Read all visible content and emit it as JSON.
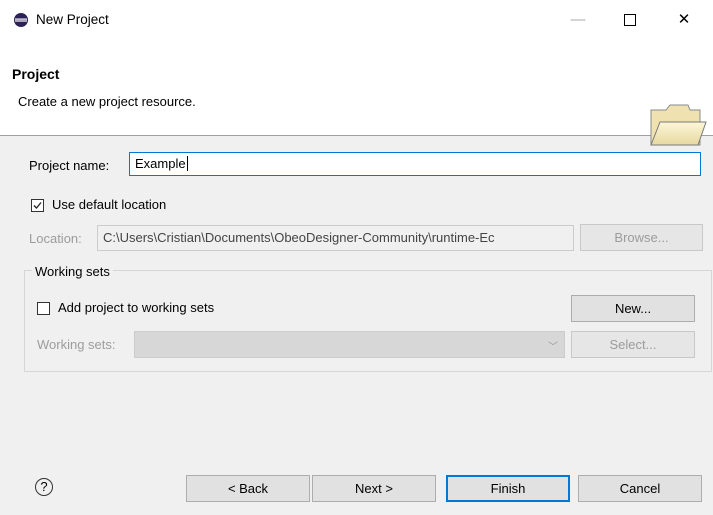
{
  "window": {
    "title": "New Project",
    "minimize_icon": "minimize-icon",
    "maximize_icon": "maximize-icon",
    "close_icon": "close-icon"
  },
  "banner": {
    "title": "Project",
    "description": "Create a new project resource.",
    "icon": "folder-icon"
  },
  "form": {
    "project_name_label": "Project name:",
    "project_name_value": "Example",
    "use_default_location_label": "Use default location",
    "use_default_location_checked": true,
    "location_label": "Location:",
    "location_value": "C:\\Users\\Cristian\\Documents\\ObeoDesigner-Community\\runtime-Ec",
    "browse_label": "Browse..."
  },
  "working_sets": {
    "group_title": "Working sets",
    "add_label": "Add project to working sets",
    "add_checked": false,
    "new_label": "New...",
    "sets_label": "Working sets:",
    "sets_value": "",
    "select_label": "Select..."
  },
  "footer": {
    "help_glyph": "?",
    "back_label": "< Back",
    "next_label": "Next >",
    "finish_label": "Finish",
    "cancel_label": "Cancel"
  }
}
